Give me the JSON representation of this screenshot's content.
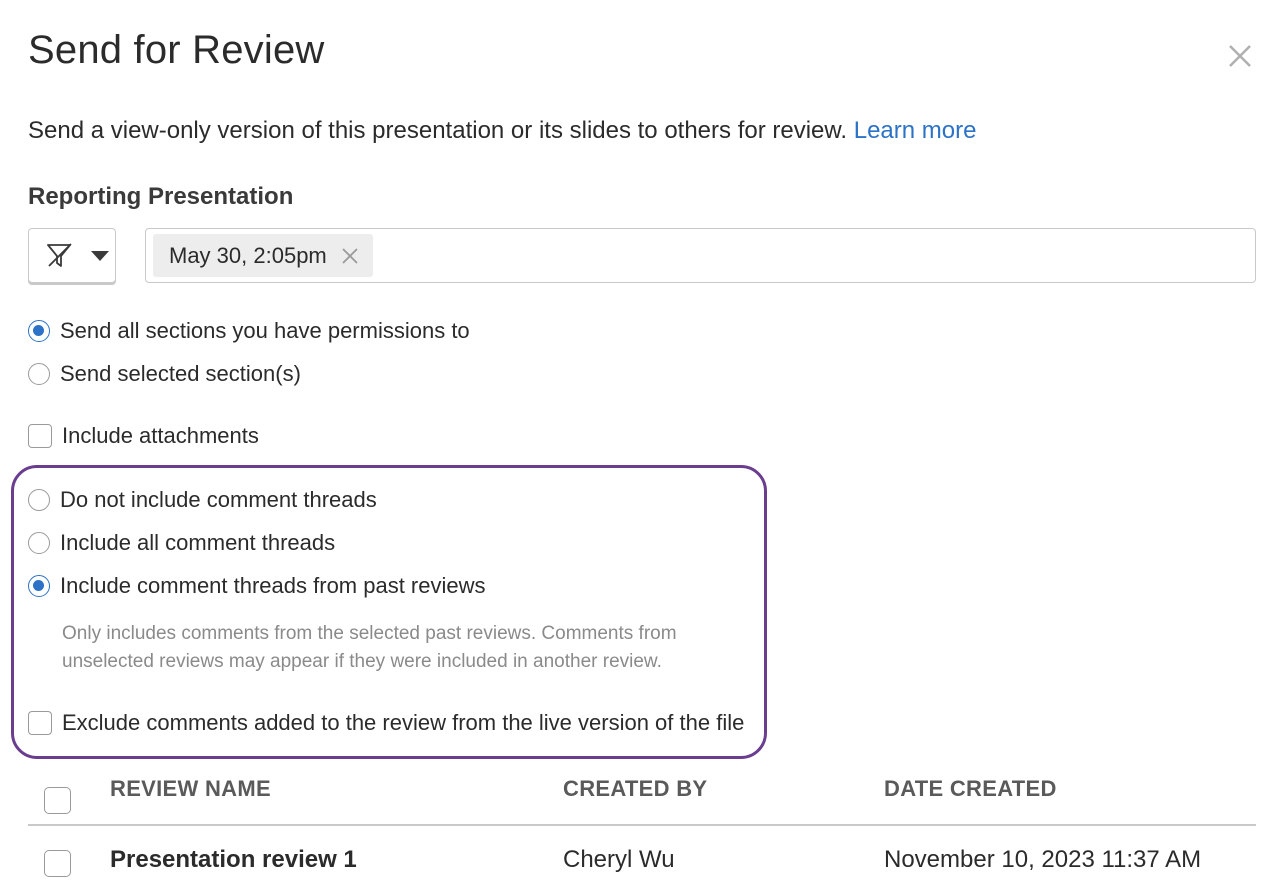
{
  "dialog": {
    "title": "Send for Review",
    "description": "Send a view-only version of this presentation or its slides to others for review.",
    "learn_more": "Learn more"
  },
  "presentation": {
    "label": "Reporting Presentation",
    "filter_icon": "filter-off-icon",
    "selected_version": "May 30, 2:05pm"
  },
  "sections": {
    "options": [
      {
        "label": "Send all sections you have permissions to",
        "checked": true
      },
      {
        "label": "Send selected section(s)",
        "checked": false
      }
    ]
  },
  "attachments": {
    "label": "Include attachments",
    "checked": false
  },
  "comments": {
    "options": [
      {
        "label": "Do not include comment threads",
        "checked": false
      },
      {
        "label": "Include all comment threads",
        "checked": false
      },
      {
        "label": "Include comment threads from past reviews",
        "checked": true
      }
    ],
    "helper_line1": "Only includes comments from the selected past reviews. Comments from",
    "helper_line2": "unselected reviews may appear if they were included in another review.",
    "exclude_label": "Exclude comments added to the review from the live version of the file",
    "exclude_checked": false
  },
  "table": {
    "columns": [
      "REVIEW NAME",
      "CREATED BY",
      "DATE CREATED"
    ],
    "rows": [
      {
        "name": "Presentation review 1",
        "created_by": "Cheryl Wu",
        "date_created": "November 10, 2023 11:37 AM"
      }
    ]
  },
  "colors": {
    "accent": "#2c72c7",
    "highlight_border": "#6a3d8f",
    "muted_text": "#8a8a8a"
  }
}
